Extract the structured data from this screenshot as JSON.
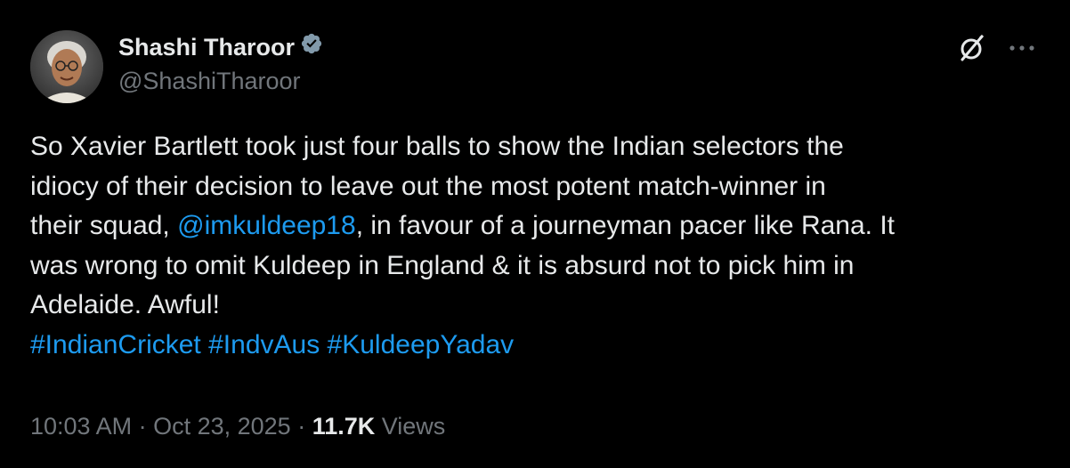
{
  "author": {
    "display_name": "Shashi Tharoor",
    "handle": "@ShashiTharoor",
    "verified_color": "#829aab"
  },
  "tweet": {
    "line1": "So Xavier Bartlett took just four balls to show the Indian selectors the",
    "line2": "idiocy of their decision to leave out the most potent match-winner in",
    "line3_prefix": "their squad, ",
    "mention": "@imkuldeep18",
    "line3_suffix": ", in favour of a journeyman pacer like Rana. It",
    "line4": "was wrong to omit Kuldeep in England & it is absurd not to pick him in",
    "line5": "Adelaide. Awful!",
    "hashtags": [
      "#IndianCricket",
      "#IndvAus",
      "#KuldeepYadav"
    ]
  },
  "meta": {
    "time": "10:03 AM",
    "separator": " · ",
    "date": "Oct 23, 2025",
    "views_count": "11.7K",
    "views_label": "Views"
  },
  "icons": {
    "grok": "grok-icon",
    "more": "more-icon",
    "verified": "verified-badge-icon"
  },
  "colors": {
    "background": "#000000",
    "text": "#e7e9ea",
    "muted": "#71767b",
    "link": "#1d9bf0"
  }
}
